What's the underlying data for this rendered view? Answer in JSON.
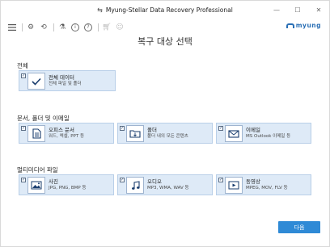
{
  "window": {
    "title": "Myung-Stellar Data Recovery Professional",
    "controls": [
      "—",
      "☐",
      "✕"
    ]
  },
  "toolbar": {
    "icons": [
      "menu-icon",
      "settings-icon",
      "history-icon",
      "recovery-icon",
      "info-icon",
      "help-icon",
      "cart-icon",
      "user-icon"
    ],
    "brand": "myung"
  },
  "page_title": "복구 대상 선택",
  "sections": [
    {
      "label": "전체",
      "cards": [
        {
          "name": "전체 데이터",
          "desc": "전체 파일 및 폴더",
          "checked": true,
          "icon": "checkmark-icon"
        }
      ]
    },
    {
      "label": "문서, 폴더 및 이메일",
      "cards": [
        {
          "name": "오피스 문서",
          "desc": "워드, 엑셀, PPT 등",
          "checked": true,
          "icon": "document-icon"
        },
        {
          "name": "폴더",
          "desc": "폴더 내의 모든 콘텐츠",
          "checked": true,
          "icon": "folder-icon"
        },
        {
          "name": "이메일",
          "desc": "MS Outlook 이메일 등",
          "checked": true,
          "icon": "email-icon"
        }
      ]
    },
    {
      "label": "멀티미디어 파일",
      "cards": [
        {
          "name": "사진",
          "desc": "JPG, PNG, BMP 등",
          "checked": true,
          "icon": "photo-icon"
        },
        {
          "name": "오디오",
          "desc": "MP3, WMA, WAV 등",
          "checked": true,
          "icon": "music-icon"
        },
        {
          "name": "동영상",
          "desc": "MPEG, MOV, FLV 등",
          "checked": true,
          "icon": "video-icon"
        }
      ]
    }
  ],
  "next_button": "다음",
  "colors": {
    "card_bg": "#deeaf7",
    "card_border": "#b9cfe8",
    "accent": "#2f8ad6",
    "brand": "#2a6fb5"
  }
}
